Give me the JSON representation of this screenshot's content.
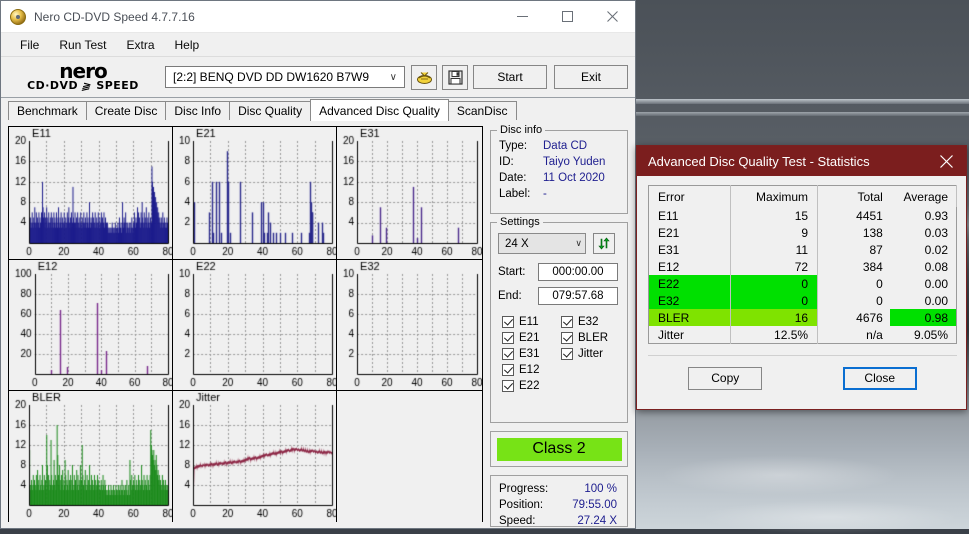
{
  "window": {
    "title": "Nero CD-DVD Speed 4.7.7.16",
    "icon": "nero-disc-icon",
    "minimize": "minimize-icon",
    "maximize": "maximize-icon",
    "close": "close-icon"
  },
  "menubar": {
    "items": [
      "File",
      "Run Test",
      "Extra",
      "Help"
    ]
  },
  "toolbar": {
    "logo_line1": "nero",
    "logo_line2a": "CD·DVD",
    "logo_line2b": "SPEED",
    "drive": "[2:2]   BENQ DVD DD DW1620 B7W9",
    "chevron": "∨",
    "eject_icon": "eject-disc-icon",
    "save_icon": "floppy-save-icon",
    "start_label": "Start",
    "exit_label": "Exit"
  },
  "tabs": [
    {
      "label": "Benchmark",
      "active": false
    },
    {
      "label": "Create Disc",
      "active": false
    },
    {
      "label": "Disc Info",
      "active": false
    },
    {
      "label": "Disc Quality",
      "active": false
    },
    {
      "label": "Advanced Disc Quality",
      "active": true
    },
    {
      "label": "ScanDisc",
      "active": false
    }
  ],
  "disc_info": {
    "caption": "Disc info",
    "rows": [
      {
        "key": "Type:",
        "value": "Data CD"
      },
      {
        "key": "ID:",
        "value": "Taiyo Yuden"
      },
      {
        "key": "Date:",
        "value": "11 Oct 2020"
      },
      {
        "key": "Label:",
        "value": "-"
      }
    ]
  },
  "settings": {
    "caption": "Settings",
    "speed": "24 X",
    "speed_chevron": "∨",
    "refresh_icon": "refresh-arrows-icon",
    "start_label": "Start:",
    "start_value": "000:00.00",
    "end_label": "End:",
    "end_value": "079:57.68",
    "checkboxes_left": [
      "E11",
      "E21",
      "E31",
      "E12",
      "E22"
    ],
    "checkboxes_right": [
      "E32",
      "BLER",
      "Jitter"
    ]
  },
  "class_badge": {
    "label": "Class 2",
    "color": "#77e316"
  },
  "progress": {
    "rows": [
      {
        "key": "Progress:",
        "value": "100 %"
      },
      {
        "key": "Position:",
        "value": "79:55.00"
      },
      {
        "key": "Speed:",
        "value": "27.24 X"
      }
    ]
  },
  "stats_dialog": {
    "title": "Advanced Disc Quality Test - Statistics",
    "close_icon": "close-icon",
    "headers": [
      "Error",
      "Maximum",
      "Total",
      "Average"
    ],
    "rows": [
      {
        "error": "E11",
        "maximum": "15",
        "total": "4451",
        "average": "0.93",
        "highlight": "none"
      },
      {
        "error": "E21",
        "maximum": "9",
        "total": "138",
        "average": "0.03",
        "highlight": "none"
      },
      {
        "error": "E31",
        "maximum": "11",
        "total": "87",
        "average": "0.02",
        "highlight": "none"
      },
      {
        "error": "E12",
        "maximum": "72",
        "total": "384",
        "average": "0.08",
        "highlight": "none"
      },
      {
        "error": "E22",
        "maximum": "0",
        "total": "0",
        "average": "0.00",
        "highlight": "green-left"
      },
      {
        "error": "E32",
        "maximum": "0",
        "total": "0",
        "average": "0.00",
        "highlight": "green-left"
      },
      {
        "error": "BLER",
        "maximum": "16",
        "total": "4676",
        "average": "0.98",
        "highlight": "yellowgreen-left-green-avg"
      },
      {
        "error": "Jitter",
        "maximum": "12.5%",
        "total": "n/a",
        "average": "9.05%",
        "highlight": "none"
      }
    ],
    "copy_label": "Copy",
    "close_label": "Close",
    "highlight_green": "#00e000",
    "highlight_yellowgreen": "#7fe300"
  },
  "chart_data": [
    {
      "type": "bar",
      "title": "E11",
      "xlabel": "",
      "ylabel": "",
      "xlim": [
        0,
        80
      ],
      "ylim": [
        0,
        20
      ],
      "xticks": [
        0,
        20,
        40,
        60,
        80
      ],
      "yticks": [
        4,
        8,
        12,
        16,
        20
      ],
      "color": "#1c1c8c",
      "grid": true,
      "filled": true,
      "values": [
        4,
        3,
        5,
        4,
        3,
        6,
        4,
        3,
        5,
        4,
        7,
        4,
        3,
        6,
        4,
        5,
        3,
        4,
        6,
        3,
        5,
        4,
        3,
        6,
        4,
        12,
        7,
        5,
        4,
        6,
        3,
        5,
        4,
        7,
        5,
        3,
        4,
        6,
        4,
        3,
        5,
        4,
        6,
        3,
        5,
        4,
        3,
        6,
        4,
        5,
        3,
        4,
        6,
        4,
        3,
        5,
        7,
        4,
        3,
        5,
        4,
        6,
        3,
        4,
        5,
        3,
        4,
        6,
        4,
        3,
        5,
        4,
        3,
        6,
        4,
        5,
        7,
        4,
        3,
        5,
        4,
        6,
        3,
        4,
        11,
        5,
        3,
        4,
        6,
        4,
        3,
        5,
        4,
        6,
        3,
        4,
        5,
        3,
        4,
        6,
        3,
        4,
        5,
        3,
        4,
        6,
        4,
        3,
        5,
        4,
        3,
        6,
        4,
        5,
        3,
        4,
        8,
        4,
        3,
        5,
        4,
        3,
        6,
        4,
        5,
        3,
        4,
        6,
        3,
        4,
        5,
        3,
        4,
        6,
        4,
        3,
        5,
        4,
        3,
        6,
        4,
        5,
        3,
        4,
        6,
        3,
        4,
        5,
        3,
        4,
        3,
        4,
        3,
        2,
        3,
        2,
        3,
        2,
        3,
        2,
        4,
        3,
        2,
        3,
        2,
        3,
        4,
        2,
        3,
        2,
        3,
        4,
        2,
        3,
        5,
        2,
        3,
        4,
        2,
        3,
        8,
        4,
        3,
        5,
        4,
        3,
        6,
        4,
        2,
        3,
        4,
        3,
        2,
        4,
        3,
        2,
        4,
        3,
        5,
        3,
        2,
        4,
        3,
        6,
        4,
        3,
        5,
        4,
        3,
        7,
        4,
        6,
        3,
        5,
        4,
        3,
        6,
        4,
        8,
        5,
        4,
        3,
        6,
        4,
        5,
        3,
        7,
        4,
        3,
        5,
        4,
        6,
        3,
        4,
        5,
        3,
        4,
        15,
        12,
        10,
        11,
        9,
        10,
        8,
        9,
        7,
        8,
        6,
        7,
        5,
        6,
        4,
        5,
        4,
        3,
        5,
        4,
        3,
        6,
        4,
        3,
        5,
        4,
        3,
        4,
        3,
        5,
        4,
        3
      ]
    },
    {
      "type": "bar",
      "title": "E21",
      "xlabel": "",
      "ylabel": "",
      "xlim": [
        0,
        80
      ],
      "ylim": [
        0,
        10
      ],
      "xticks": [
        0,
        20,
        40,
        60,
        80
      ],
      "yticks": [
        2,
        4,
        6,
        8,
        10
      ],
      "color": "#2a2a8c",
      "grid": true,
      "filled": false,
      "spikes": [
        [
          0.5,
          4
        ],
        [
          9,
          3
        ],
        [
          11,
          6
        ],
        [
          11.6,
          1
        ],
        [
          13,
          6
        ],
        [
          15,
          6
        ],
        [
          16,
          1
        ],
        [
          19.8,
          9
        ],
        [
          20.3,
          6
        ],
        [
          21,
          1
        ],
        [
          27,
          6
        ],
        [
          34,
          3
        ],
        [
          39,
          4
        ],
        [
          40,
          4
        ],
        [
          41,
          1
        ],
        [
          42.5,
          1
        ],
        [
          43,
          3
        ],
        [
          44,
          2
        ],
        [
          46,
          1
        ],
        [
          48,
          1
        ],
        [
          50,
          1
        ],
        [
          53,
          1
        ],
        [
          57,
          1
        ],
        [
          62,
          1
        ],
        [
          66.5,
          1
        ],
        [
          67.5,
          6
        ],
        [
          68,
          4
        ],
        [
          68.3,
          3
        ],
        [
          68.6,
          3
        ],
        [
          72,
          2
        ],
        [
          74,
          2
        ],
        [
          75,
          1
        ]
      ]
    },
    {
      "type": "bar",
      "title": "E31",
      "xlabel": "",
      "ylabel": "",
      "xlim": [
        0,
        80
      ],
      "ylim": [
        0,
        20
      ],
      "xticks": [
        0,
        20,
        40,
        60,
        80
      ],
      "yticks": [
        4,
        8,
        12,
        16,
        20
      ],
      "color": "#4b2a8c",
      "grid": true,
      "filled": false,
      "spikes": [
        [
          10,
          1.5
        ],
        [
          15,
          7
        ],
        [
          19.5,
          3
        ],
        [
          37.5,
          11
        ],
        [
          40,
          1
        ],
        [
          42.5,
          7
        ],
        [
          67.5,
          3
        ]
      ]
    },
    {
      "type": "bar",
      "title": "E12",
      "xlabel": "",
      "ylabel": "",
      "xlim": [
        0,
        80
      ],
      "ylim": [
        0,
        100
      ],
      "xticks": [
        0,
        20,
        40,
        60,
        80
      ],
      "yticks": [
        20,
        40,
        60,
        80,
        100
      ],
      "color": "#7a2a8c",
      "grid": true,
      "filled": false,
      "spikes": [
        [
          10,
          4
        ],
        [
          15,
          64
        ],
        [
          19.5,
          7
        ],
        [
          37.5,
          71
        ],
        [
          40,
          4
        ],
        [
          42.5,
          23
        ],
        [
          67.5,
          8
        ]
      ]
    },
    {
      "type": "bar",
      "title": "E22",
      "xlabel": "",
      "ylabel": "",
      "xlim": [
        0,
        80
      ],
      "ylim": [
        0,
        10
      ],
      "xticks": [
        0,
        20,
        40,
        60,
        80
      ],
      "yticks": [
        2,
        4,
        6,
        8,
        10
      ],
      "color": "#7a2a8c",
      "grid": true,
      "filled": false,
      "spikes": []
    },
    {
      "type": "bar",
      "title": "E32",
      "xlabel": "",
      "ylabel": "",
      "xlim": [
        0,
        80
      ],
      "ylim": [
        0,
        10
      ],
      "xticks": [
        0,
        20,
        40,
        60,
        80
      ],
      "yticks": [
        2,
        4,
        6,
        8,
        10
      ],
      "color": "#7a2a8c",
      "grid": true,
      "filled": false,
      "spikes": []
    },
    {
      "type": "bar",
      "title": "BLER",
      "xlabel": "",
      "ylabel": "",
      "xlim": [
        0,
        80
      ],
      "ylim": [
        0,
        20
      ],
      "xticks": [
        0,
        20,
        40,
        60,
        80
      ],
      "yticks": [
        4,
        8,
        12,
        16,
        20
      ],
      "color": "#1a8a1a",
      "grid": true,
      "filled": true,
      "values": [
        11,
        4,
        3,
        5,
        4,
        3,
        6,
        4,
        5,
        3,
        4,
        6,
        3,
        7,
        4,
        5,
        3,
        6,
        4,
        3,
        5,
        8,
        4,
        3,
        6,
        4,
        5,
        3,
        14,
        8,
        4,
        6,
        3,
        5,
        4,
        13,
        6,
        4,
        3,
        5,
        9,
        4,
        6,
        3,
        5,
        16,
        10,
        6,
        4,
        8,
        5,
        3,
        6,
        4,
        7,
        3,
        5,
        4,
        9,
        6,
        3,
        5,
        4,
        7,
        3,
        5,
        4,
        6,
        3,
        5,
        8,
        4,
        3,
        6,
        4,
        5,
        3,
        7,
        4,
        6,
        3,
        5,
        4,
        8,
        3,
        5,
        12,
        6,
        4,
        3,
        5,
        7,
        4,
        3,
        6,
        4,
        5,
        3,
        8,
        4,
        3,
        6,
        4,
        5,
        3,
        4,
        6,
        3,
        5,
        4,
        3,
        6,
        4,
        5,
        3,
        4,
        3,
        5,
        4,
        3,
        6,
        4,
        3,
        5,
        4,
        2,
        3,
        2,
        3,
        4,
        2,
        3,
        2,
        4,
        3,
        2,
        3,
        4,
        2,
        3,
        2,
        4,
        3,
        2,
        3,
        4,
        2,
        3,
        4,
        2,
        3,
        5,
        3,
        2,
        4,
        3,
        2,
        4,
        3,
        5,
        2,
        3,
        4,
        2,
        9,
        5,
        3,
        6,
        4,
        3,
        5,
        4,
        6,
        3,
        4,
        5,
        3,
        4,
        6,
        3,
        5,
        4,
        3,
        8,
        5,
        4,
        3,
        6,
        4,
        5,
        3,
        4,
        6,
        3,
        5,
        4,
        3,
        6,
        15,
        12,
        11,
        10,
        9,
        11,
        8,
        9,
        7,
        10,
        8,
        6,
        7,
        5,
        6,
        4,
        5,
        3,
        4,
        6,
        3,
        5,
        4,
        3,
        5,
        4,
        3,
        4,
        3
      ]
    },
    {
      "type": "line",
      "title": "Jitter",
      "xlabel": "",
      "ylabel": "",
      "xlim": [
        0,
        80
      ],
      "ylim": [
        0,
        20
      ],
      "xticks": [
        0,
        20,
        40,
        60,
        80
      ],
      "yticks": [
        4,
        8,
        12,
        16,
        20
      ],
      "color": "#8c2444",
      "grid": true,
      "values": [
        0,
        7.1,
        7.3,
        7.6,
        7.4,
        7.7,
        7.5,
        7.8,
        7.6,
        7.9,
        7.7,
        8.0,
        7.8,
        7.9,
        7.7,
        8.1,
        7.9,
        8.0,
        7.8,
        8.1,
        7.9,
        8.2,
        8.0,
        7.8,
        8.1,
        7.9,
        8.2,
        8.0,
        8.3,
        8.1,
        7.9,
        8.2,
        8.0,
        8.3,
        8.1,
        8.4,
        8.2,
        8.0,
        8.3,
        8.1,
        8.4,
        8.2,
        8.5,
        8.3,
        8.1,
        8.4,
        8.2,
        8.5,
        8.3,
        8.6,
        8.4,
        8.2,
        8.5,
        8.3,
        8.6,
        8.4,
        8.7,
        8.5,
        8.3,
        8.6,
        8.4,
        8.7,
        8.5,
        8.8,
        8.6,
        8.4,
        8.7,
        8.5,
        8.8,
        8.6,
        8.9,
        8.7,
        8.5,
        8.8,
        8.6,
        8.9,
        8.7,
        9.0,
        8.8,
        9.1,
        8.9,
        9.2,
        9.0,
        9.4,
        9.2,
        9.5,
        9.3,
        9.0,
        9.3,
        9.1,
        9.4,
        9.2,
        9.5,
        9.3,
        9.6,
        9.4,
        9.2,
        9.5,
        9.3,
        9.6,
        9.4,
        9.7,
        9.5,
        9.8,
        9.6,
        9.9,
        9.7,
        10.0,
        9.8,
        10.1,
        9.9,
        10.2,
        10.0,
        9.8,
        10.1,
        9.9,
        10.2,
        10.0,
        10.3,
        10.1,
        10.4,
        10.2,
        10.5,
        10.3,
        10.1,
        10.4,
        10.2,
        10.5,
        10.3,
        10.6,
        10.4,
        10.7,
        10.5,
        10.8,
        10.6,
        10.4,
        10.7,
        10.5,
        10.8,
        10.6,
        10.9,
        10.7,
        11.0,
        10.8,
        11.1,
        10.9,
        10.7,
        11.0,
        10.8,
        11.2,
        11.0,
        11.3,
        11.1,
        10.9,
        11.2,
        11.0,
        11.3,
        11.1,
        10.9,
        11.2,
        11.0,
        10.8,
        11.1,
        10.9,
        11.2,
        11.0,
        10.8,
        11.1,
        10.9,
        10.7,
        11.0,
        10.8,
        10.6,
        10.9,
        10.7,
        10.5,
        10.8,
        10.6,
        10.9,
        10.7,
        11.0,
        10.8,
        10.6,
        10.9,
        10.7,
        10.5,
        10.8,
        10.6,
        10.4,
        10.7,
        10.5,
        10.8,
        10.6,
        10.4,
        10.7,
        10.5,
        10.3,
        10.6,
        10.4,
        10.7,
        10.5,
        10.3,
        10.6,
        10.4,
        10.8,
        10.6,
        10.4,
        10.7,
        10.5,
        10.3,
        10.6
      ]
    }
  ]
}
